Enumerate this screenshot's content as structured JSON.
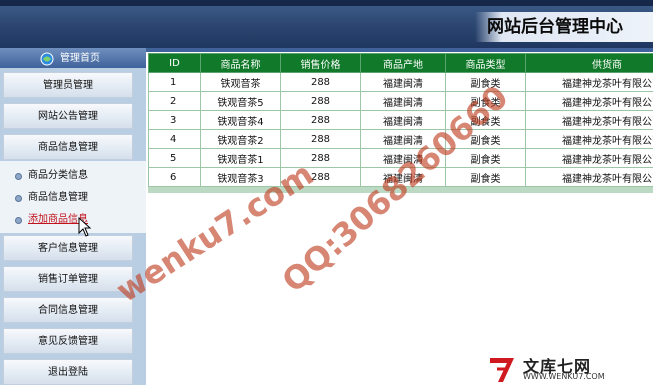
{
  "header": {
    "title": "网站后台管理中心"
  },
  "sidebar": {
    "home_label": "管理首页",
    "top_items": [
      {
        "label": "管理员管理"
      },
      {
        "label": "网站公告管理"
      },
      {
        "label": "商品信息管理"
      }
    ],
    "sub_items": [
      {
        "label": "商品分类信息"
      },
      {
        "label": "商品信息管理"
      },
      {
        "label": "添加商品信息",
        "active": true
      }
    ],
    "bottom_items": [
      {
        "label": "客户信息管理"
      },
      {
        "label": "销售订单管理"
      },
      {
        "label": "合同信息管理"
      },
      {
        "label": "意见反馈管理"
      },
      {
        "label": "退出登陆"
      }
    ]
  },
  "table": {
    "headers": [
      "ID",
      "商品名称",
      "销售价格",
      "商品产地",
      "商品类型",
      "供货商"
    ],
    "rows": [
      [
        "1",
        "铁观音茶",
        "288",
        "福建闽清",
        "副食类",
        "福建神龙茶叶有限公司"
      ],
      [
        "2",
        "铁观音茶5",
        "288",
        "福建闽清",
        "副食类",
        "福建神龙茶叶有限公司"
      ],
      [
        "3",
        "铁观音茶4",
        "288",
        "福建闽清",
        "副食类",
        "福建神龙茶叶有限公司"
      ],
      [
        "4",
        "铁观音茶2",
        "288",
        "福建闽清",
        "副食类",
        "福建神龙茶叶有限公司"
      ],
      [
        "5",
        "铁观音茶1",
        "288",
        "福建闽清",
        "副食类",
        "福建神龙茶叶有限公司"
      ],
      [
        "6",
        "铁观音茶3",
        "288",
        "福建闽清",
        "副食类",
        "福建神龙茶叶有限公司"
      ]
    ]
  },
  "watermarks": {
    "site": "wenku7.com",
    "qq": "QQ:3068260660",
    "logo_text": "文库七网",
    "logo_site": "WWW.WENKU7.COM"
  },
  "icons": {
    "home": "home-icon",
    "bullet": "bullet-icon",
    "cursor": "mouse-cursor-icon",
    "logo": "wenku7-logo-icon"
  },
  "colors": {
    "header_blue": "#2a4570",
    "sidebar_bg": "#b9cde3",
    "table_header_green": "#117a2a",
    "active_link_red": "#c0121b",
    "watermark": "#be3c1e"
  }
}
